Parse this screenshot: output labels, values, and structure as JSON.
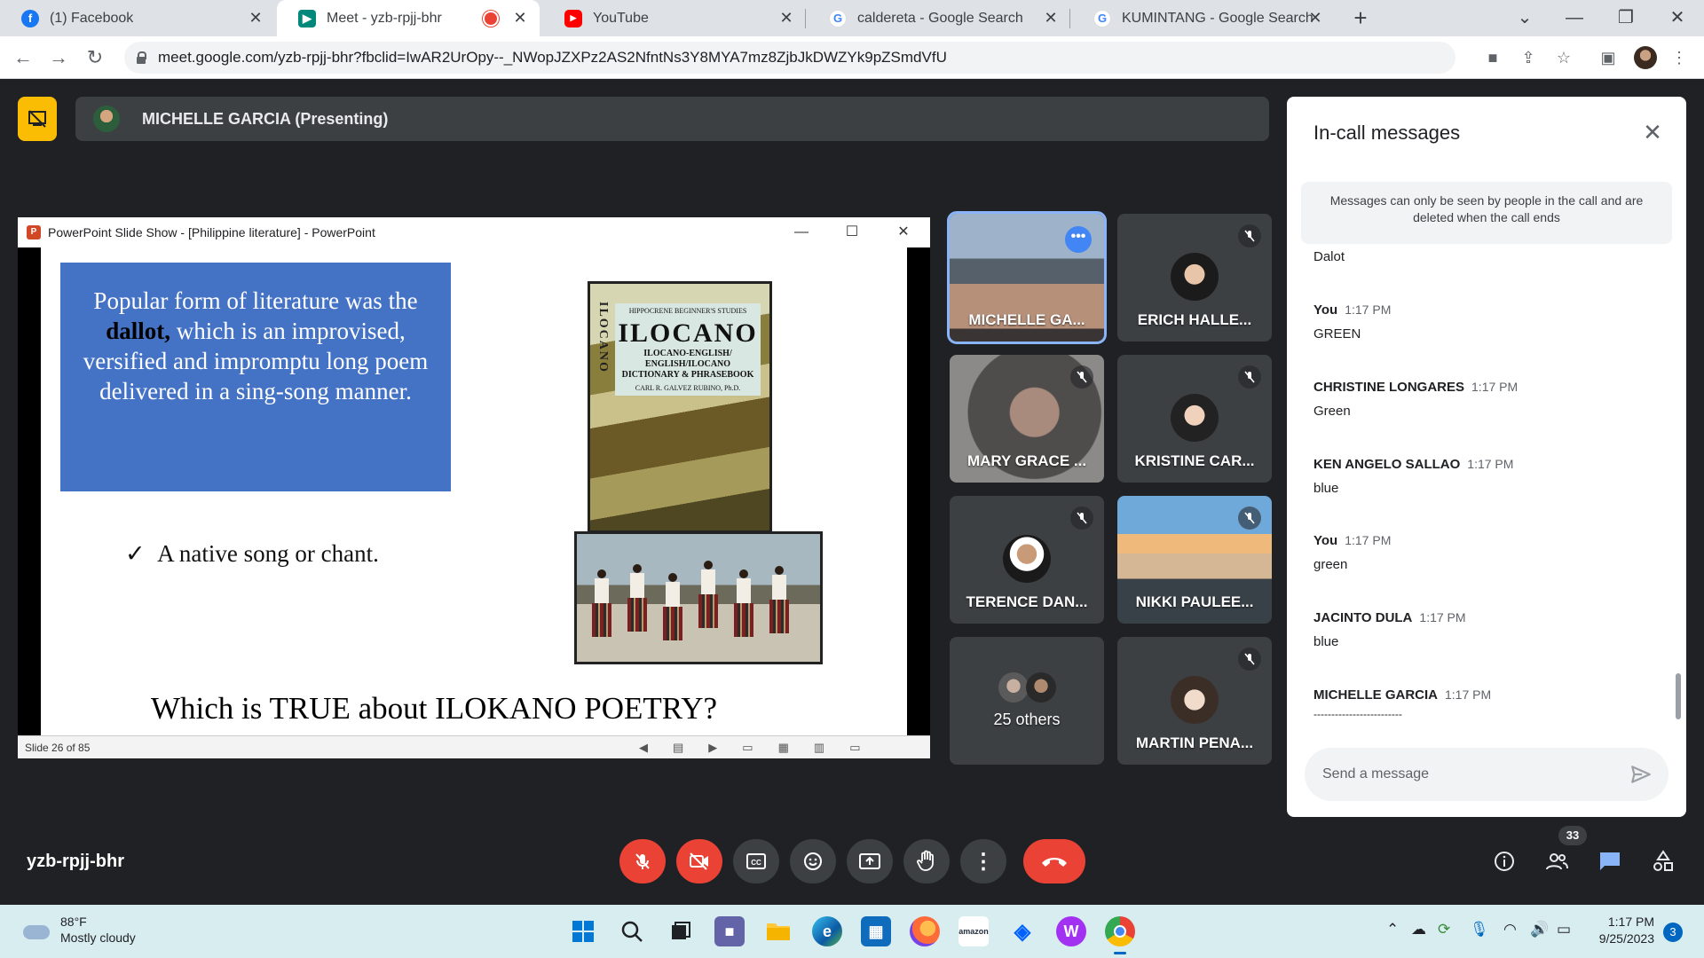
{
  "browser": {
    "tabs": [
      {
        "label": "(1) Facebook",
        "icon": "facebook-icon",
        "color": "#1877f2",
        "glyph": "f",
        "active": false
      },
      {
        "label": "Meet - yzb-rpjj-bhr",
        "icon": "google-meet-icon",
        "color": "#00897b",
        "glyph": "▶",
        "active": true
      },
      {
        "label": "YouTube",
        "icon": "youtube-icon",
        "color": "#ff0000",
        "glyph": "▶",
        "active": false
      },
      {
        "label": "caldereta - Google Search",
        "icon": "google-icon",
        "color": "#4285f4",
        "glyph": "G",
        "active": false
      },
      {
        "label": "KUMINTANG - Google Search",
        "icon": "google-icon",
        "color": "#4285f4",
        "glyph": "G",
        "active": false
      }
    ],
    "url": "meet.google.com/yzb-rpjj-bhr?fbclid=IwAR2UrOpy--_NWopJZXPz2AS2NfntNs3Y8MYA7mz8ZjbJkDWZYk9pZSmdVfU"
  },
  "meet": {
    "presenter_label": "MICHELLE GARCIA (Presenting)",
    "meeting_code": "yzb-rpjj-bhr",
    "people_count": "33"
  },
  "presentation": {
    "window_title": "PowerPoint Slide Show - [Philippine literature] - PowerPoint",
    "slide_status": "Slide 26 of 85",
    "blue_text_before": "Popular form of literature was the ",
    "blue_text_bold": "dallot,",
    "blue_text_after": " which is an improvised, versified and impromptu long poem delivered in a sing-song manner.",
    "check_mark": "✓",
    "check_text": "A native song or chant.",
    "question": "Which is TRUE about ILOKANO POETRY?",
    "book_top": "HIPPOCRENE   BEGINNER'S STUDIES",
    "book_title": "ILOCANO",
    "book_subtitle_1": "ILOCANO-ENGLISH/",
    "book_subtitle_2": "ENGLISH/ILOCANO",
    "book_subtitle_3": "DICTIONARY & PHRASEBOOK",
    "book_author": "CARL R. GALVEZ RUBINO, Ph.D.",
    "book_spine": "ILOCANO"
  },
  "participants": [
    {
      "name": "MICHELLE GA...",
      "muted": false,
      "speaking": true
    },
    {
      "name": "ERICH HALLE...",
      "muted": true
    },
    {
      "name": "MARY GRACE ...",
      "muted": true
    },
    {
      "name": "KRISTINE CAR...",
      "muted": true
    },
    {
      "name": "TERENCE DAN...",
      "muted": true
    },
    {
      "name": "NIKKI PAULEE...",
      "muted": true
    },
    {
      "name": "25 others"
    },
    {
      "name": "MARTIN PENA...",
      "muted": true
    }
  ],
  "chat": {
    "title": "In-call messages",
    "notice": "Messages can only be seen by people in the call and are deleted when the call ends",
    "partial_top": "Dalot",
    "messages": [
      {
        "sender": "You",
        "time": "1:17 PM",
        "text": "GREEN"
      },
      {
        "sender": "CHRISTINE LONGARES",
        "time": "1:17 PM",
        "text": "Green"
      },
      {
        "sender": "KEN ANGELO SALLAO",
        "time": "1:17 PM",
        "text": "blue"
      },
      {
        "sender": "You",
        "time": "1:17 PM",
        "text": "green"
      },
      {
        "sender": "JACINTO DULA",
        "time": "1:17 PM",
        "text": "blue"
      },
      {
        "sender": "MICHELLE GARCIA",
        "time": "1:17 PM",
        "text": "-------------------------"
      }
    ],
    "input_placeholder": "Send a message"
  },
  "taskbar": {
    "temperature": "88°F",
    "weather": "Mostly cloudy",
    "time": "1:17 PM",
    "date": "9/25/2023",
    "notifications": "3"
  }
}
